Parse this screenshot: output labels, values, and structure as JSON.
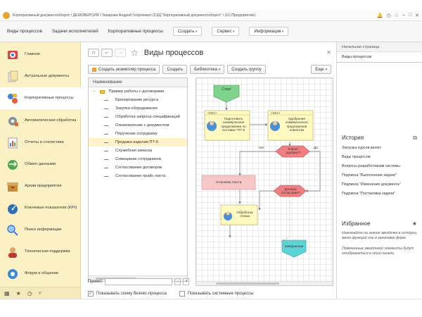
{
  "window": {
    "title": "Корпоративный документооборот / ДЕМОВЕРСИЯ / Захарова Андрей Георгиевич (СКД \"Корпоративный документооборот\" / (1С:Предприятие)"
  },
  "menubar": {
    "items": [
      "Виды процессов",
      "Задачи исполнителей",
      "Корпоративные процессы"
    ],
    "dropdowns": [
      "Создать",
      "Сервис",
      "Информация"
    ]
  },
  "sidebar": {
    "items": [
      {
        "label": "Главное",
        "icon": "home-icon"
      },
      {
        "label": "Актуальные документы",
        "icon": "documents-icon"
      },
      {
        "label": "Корпоративные процессы",
        "icon": "processes-icon"
      },
      {
        "label": "Автоматическая обработка",
        "icon": "gear-icon"
      },
      {
        "label": "Отчеты и статистика",
        "icon": "report-icon"
      },
      {
        "label": "Обмен данными",
        "icon": "exchange-icon"
      },
      {
        "label": "Архив предприятия",
        "icon": "archive-icon"
      },
      {
        "label": "Ключевые показатели (KPI)",
        "icon": "kpi-icon"
      },
      {
        "label": "Поиск информации",
        "icon": "search-icon"
      },
      {
        "label": "Техническая поддержка",
        "icon": "support-icon"
      },
      {
        "label": "Форум и общение",
        "icon": "forum-icon"
      }
    ],
    "active_index": 2
  },
  "main": {
    "title": "Виды процессов",
    "toolbar": {
      "create_instance": "Создать экземпляр процесса",
      "create": "Создать",
      "library": "Библиотека",
      "create_group": "Создать группу",
      "more": "Еще"
    },
    "list": {
      "header": "Наименование",
      "rows": [
        {
          "label": "Пример работы с договорами",
          "type": "folder"
        },
        {
          "label": "Бронирование ресурса",
          "type": "item"
        },
        {
          "label": "Закупка оборудования",
          "type": "item"
        },
        {
          "label": "Обработка запроса спецификаций",
          "type": "item"
        },
        {
          "label": "Ознакомление с документом",
          "type": "item"
        },
        {
          "label": "Поручение сотруднику",
          "type": "item"
        },
        {
          "label": "Продажа изделия ПТ-6",
          "type": "item",
          "selected": true
        },
        {
          "label": "Служебная записка",
          "type": "item"
        },
        {
          "label": "Совещание сотрудников",
          "type": "item"
        },
        {
          "label": "Согласование договоров",
          "type": "item"
        },
        {
          "label": "Согласование прайс-листа",
          "type": "item"
        }
      ]
    },
    "project_label": "Проект:",
    "checkboxes": {
      "show_schema": "Показывать схему бизнес-процесса",
      "show_system": "Показывать системные процессы"
    },
    "diagram": {
      "start": "Старт",
      "task1_head": "<Нет>",
      "task1": "Подготовить коммерческое предложение по поставке \"ПТ-5",
      "task2_head": "<Нет>",
      "task2": "Одобрение коммерческого предложения клиентом",
      "decision1": "Клиент одобрил?",
      "no_label": "Нет",
      "yes_label": "Да",
      "set_price": "Установка текста",
      "decision2": "Договор согласован?",
      "task3": "Обработка отказа",
      "end": "Завершение"
    }
  },
  "right_panel": {
    "tab_start": "Начальная страница",
    "tab_selected": "Виды процессов",
    "history_title": "История",
    "history_items": [
      "Загрузка курсов валют",
      "Виды процессов",
      "Вопросы разработчикам системы",
      "Подписка \"Выполнение задачи\"",
      "Подписка \"Изменение документа\"",
      "Подписка \"Постановка задачи\""
    ],
    "favorites_title": "Избранное",
    "favorites_text1": "Нажимайте на значок звездочка в истории, меню функций или в заголовке форм.",
    "favorites_text2": "Помеченные звездочкой элементы будут отображаться в этой панели."
  },
  "colors": {
    "sidebar_bg": "#fcf1c4",
    "selection": "#fff3c7",
    "start_node": "#7dd48a",
    "decision": "#f07f82",
    "end_node": "#5cd4d6",
    "task": "#fffac2"
  }
}
